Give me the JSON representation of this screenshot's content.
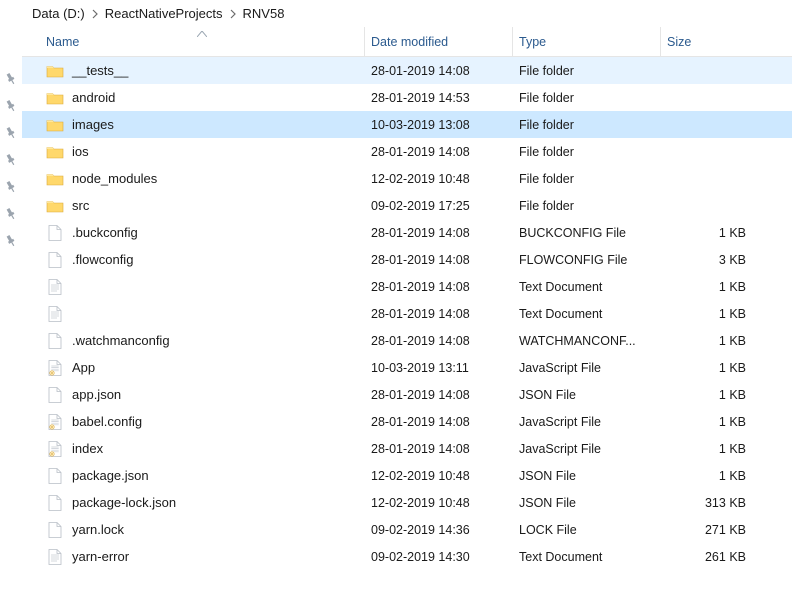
{
  "breadcrumb": [
    {
      "label": "Data (D:)"
    },
    {
      "label": "ReactNativeProjects"
    },
    {
      "label": "RNV58"
    }
  ],
  "columns": {
    "name": "Name",
    "date": "Date modified",
    "type": "Type",
    "size": "Size"
  },
  "sort": {
    "column": "name",
    "direction": "asc"
  },
  "selection_mode": "both",
  "icons": {
    "folder": "folder-icon",
    "file": "file-icon",
    "text": "text-file-icon",
    "js": "js-file-icon"
  },
  "rows": [
    {
      "name": "__tests__",
      "icon": "folder",
      "date": "28-01-2019 14:08",
      "type": "File folder",
      "size": "",
      "selected": "light"
    },
    {
      "name": "android",
      "icon": "folder",
      "date": "28-01-2019 14:53",
      "type": "File folder",
      "size": ""
    },
    {
      "name": "images",
      "icon": "folder",
      "date": "10-03-2019 13:08",
      "type": "File folder",
      "size": "",
      "selected": "strong"
    },
    {
      "name": "ios",
      "icon": "folder",
      "date": "28-01-2019 14:08",
      "type": "File folder",
      "size": ""
    },
    {
      "name": "node_modules",
      "icon": "folder",
      "date": "12-02-2019 10:48",
      "type": "File folder",
      "size": ""
    },
    {
      "name": "src",
      "icon": "folder",
      "date": "09-02-2019 17:25",
      "type": "File folder",
      "size": ""
    },
    {
      "name": ".buckconfig",
      "icon": "file",
      "date": "28-01-2019 14:08",
      "type": "BUCKCONFIG File",
      "size": "1 KB"
    },
    {
      "name": ".flowconfig",
      "icon": "file",
      "date": "28-01-2019 14:08",
      "type": "FLOWCONFIG File",
      "size": "3 KB"
    },
    {
      "name": "",
      "icon": "text",
      "date": "28-01-2019 14:08",
      "type": "Text Document",
      "size": "1 KB"
    },
    {
      "name": "",
      "icon": "text",
      "date": "28-01-2019 14:08",
      "type": "Text Document",
      "size": "1 KB"
    },
    {
      "name": ".watchmanconfig",
      "icon": "file",
      "date": "28-01-2019 14:08",
      "type": "WATCHMANCONF...",
      "size": "1 KB"
    },
    {
      "name": "App",
      "icon": "js",
      "date": "10-03-2019 13:11",
      "type": "JavaScript File",
      "size": "1 KB"
    },
    {
      "name": "app.json",
      "icon": "file",
      "date": "28-01-2019 14:08",
      "type": "JSON File",
      "size": "1 KB"
    },
    {
      "name": "babel.config",
      "icon": "js",
      "date": "28-01-2019 14:08",
      "type": "JavaScript File",
      "size": "1 KB"
    },
    {
      "name": "index",
      "icon": "js",
      "date": "28-01-2019 14:08",
      "type": "JavaScript File",
      "size": "1 KB"
    },
    {
      "name": "package.json",
      "icon": "file",
      "date": "12-02-2019 10:48",
      "type": "JSON File",
      "size": "1 KB"
    },
    {
      "name": "package-lock.json",
      "icon": "file",
      "date": "12-02-2019 10:48",
      "type": "JSON File",
      "size": "313 KB"
    },
    {
      "name": "yarn.lock",
      "icon": "file",
      "date": "09-02-2019 14:36",
      "type": "LOCK File",
      "size": "271 KB"
    },
    {
      "name": "yarn-error",
      "icon": "text",
      "date": "09-02-2019 14:30",
      "type": "Text Document",
      "size": "261 KB"
    }
  ],
  "pin_count": 7
}
